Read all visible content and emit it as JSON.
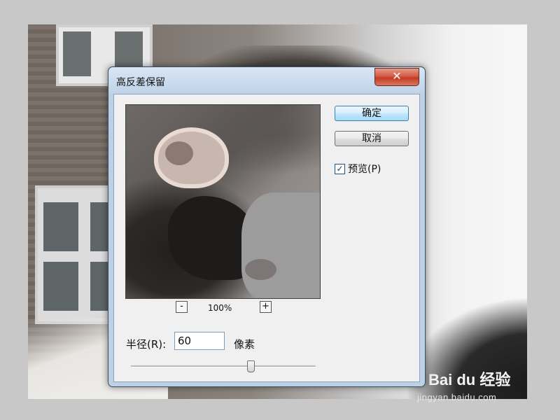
{
  "dialog": {
    "title": "高反差保留",
    "close_glyph": "✕"
  },
  "buttons": {
    "ok_label": "确定",
    "cancel_label": "取消"
  },
  "preview_option": {
    "label": "预览(P)",
    "checked": true,
    "check_glyph": "✓"
  },
  "zoom": {
    "out_glyph": "-",
    "in_glyph": "+",
    "level": "100%"
  },
  "radius": {
    "label": "半径(R):",
    "value": "60",
    "unit": "像素",
    "slider_fraction": 0.65
  },
  "watermark": {
    "logo_text": "Bai du 经验",
    "url_text": "jingyan.baidu.com"
  }
}
